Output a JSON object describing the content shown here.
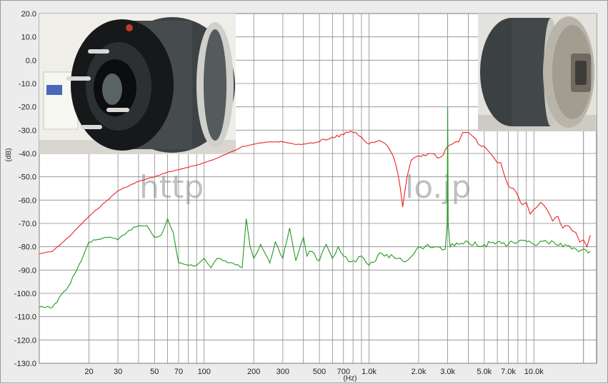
{
  "chart_data": {
    "type": "line",
    "xlabel": "(Hz)",
    "ylabel": "(dB)",
    "x_scale": "log",
    "xlim": [
      10,
      24000
    ],
    "ylim": [
      -130,
      20
    ],
    "grid": true,
    "x_ticks": [
      {
        "value": 20,
        "label": "20"
      },
      {
        "value": 30,
        "label": "30"
      },
      {
        "value": 50,
        "label": "50"
      },
      {
        "value": 70,
        "label": "70"
      },
      {
        "value": 100,
        "label": "100"
      },
      {
        "value": 200,
        "label": "200"
      },
      {
        "value": 300,
        "label": "300"
      },
      {
        "value": 500,
        "label": "500"
      },
      {
        "value": 700,
        "label": "700"
      },
      {
        "value": 1000,
        "label": "1.0k"
      },
      {
        "value": 2000,
        "label": "2.0k"
      },
      {
        "value": 3000,
        "label": "3.0k"
      },
      {
        "value": 5000,
        "label": "5.0k"
      },
      {
        "value": 7000,
        "label": "7.0k"
      },
      {
        "value": 10000,
        "label": "10.0k"
      }
    ],
    "y_ticks": [
      {
        "value": 20,
        "label": "20.0"
      },
      {
        "value": 10,
        "label": "10.0"
      },
      {
        "value": 0,
        "label": "0.0"
      },
      {
        "value": -10,
        "label": "-10.0"
      },
      {
        "value": -20,
        "label": "-20.0"
      },
      {
        "value": -30,
        "label": "-30.0"
      },
      {
        "value": -40,
        "label": "-40.0"
      },
      {
        "value": -50,
        "label": "-50.0"
      },
      {
        "value": -60,
        "label": "-60.0"
      },
      {
        "value": -70,
        "label": "-70.0"
      },
      {
        "value": -80,
        "label": "-80.0"
      },
      {
        "value": -90,
        "label": "-90.0"
      },
      {
        "value": -100,
        "label": "-100.0"
      },
      {
        "value": -110,
        "label": "-110.0"
      },
      {
        "value": -120,
        "label": "-120.0"
      },
      {
        "value": -130,
        "label": "-130.0"
      }
    ],
    "series": [
      {
        "color": "#ee2222",
        "x": [
          10,
          12,
          15,
          20,
          25,
          30,
          40,
          50,
          60,
          70,
          80,
          100,
          120,
          150,
          170,
          200,
          250,
          300,
          350,
          400,
          500,
          600,
          700,
          750,
          800,
          900,
          1000,
          1100,
          1200,
          1300,
          1400,
          1500,
          1550,
          1600,
          1700,
          1800,
          2000,
          2200,
          2400,
          2600,
          2800,
          3000,
          3200,
          3500,
          3700,
          4000,
          4300,
          4600,
          5000,
          5300,
          5600,
          6000,
          6300,
          6600,
          7000,
          7500,
          8000,
          8500,
          9000,
          9500,
          10000,
          11000,
          12000,
          13000,
          14000,
          15000,
          16000,
          17000,
          18000,
          19000,
          20000,
          21000,
          22000
        ],
        "y": [
          -83,
          -82,
          -76,
          -67,
          -61,
          -56,
          -52,
          -50,
          -48,
          -47,
          -46,
          -44,
          -42,
          -39,
          -37,
          -36,
          -35,
          -35,
          -36,
          -36,
          -35,
          -33,
          -32,
          -31,
          -31,
          -33,
          -36,
          -35,
          -35,
          -37,
          -41,
          -49,
          -55,
          -63,
          -50,
          -43,
          -41,
          -41,
          -40,
          -42,
          -41,
          -37,
          -36,
          -35,
          -31,
          -31,
          -33,
          -36,
          -37,
          -39,
          -41,
          -44,
          -44,
          -49,
          -54,
          -55,
          -58,
          -62,
          -61,
          -66,
          -64,
          -61,
          -64,
          -69,
          -67,
          -72,
          -71,
          -73,
          -74,
          -78,
          -77,
          -80,
          -75
        ]
      },
      {
        "color": "#229922",
        "x": [
          10,
          12,
          15,
          18,
          20,
          25,
          30,
          35,
          40,
          45,
          50,
          55,
          60,
          65,
          70,
          80,
          90,
          100,
          110,
          120,
          130,
          150,
          170,
          180,
          190,
          200,
          220,
          250,
          270,
          300,
          330,
          360,
          400,
          420,
          450,
          500,
          550,
          600,
          650,
          700,
          800,
          900,
          1000,
          1200,
          1500,
          1700,
          2000,
          2500,
          2900,
          2980,
          3000,
          3020,
          3100,
          3500,
          4000,
          5000,
          6000,
          7000,
          8000,
          10000,
          12000,
          15000,
          18000,
          20000,
          22000
        ],
        "y": [
          -106,
          -106,
          -97,
          -86,
          -78,
          -76,
          -77,
          -73,
          -71,
          -71,
          -76,
          -75,
          -68,
          -74,
          -87,
          -88,
          -88,
          -85,
          -89,
          -85,
          -86,
          -87,
          -89,
          -68,
          -80,
          -85,
          -79,
          -87,
          -78,
          -85,
          -72,
          -86,
          -76,
          -84,
          -82,
          -86,
          -79,
          -85,
          -80,
          -84,
          -86,
          -84,
          -88,
          -83,
          -85,
          -86,
          -80,
          -80,
          -81,
          -70,
          -20,
          -70,
          -80,
          -79,
          -78,
          -79,
          -78,
          -79,
          -78,
          -79,
          -78,
          -80,
          -81,
          -81,
          -82
        ]
      }
    ]
  },
  "watermark": {
    "left_text": "http",
    "right_text": "lo.jp"
  }
}
